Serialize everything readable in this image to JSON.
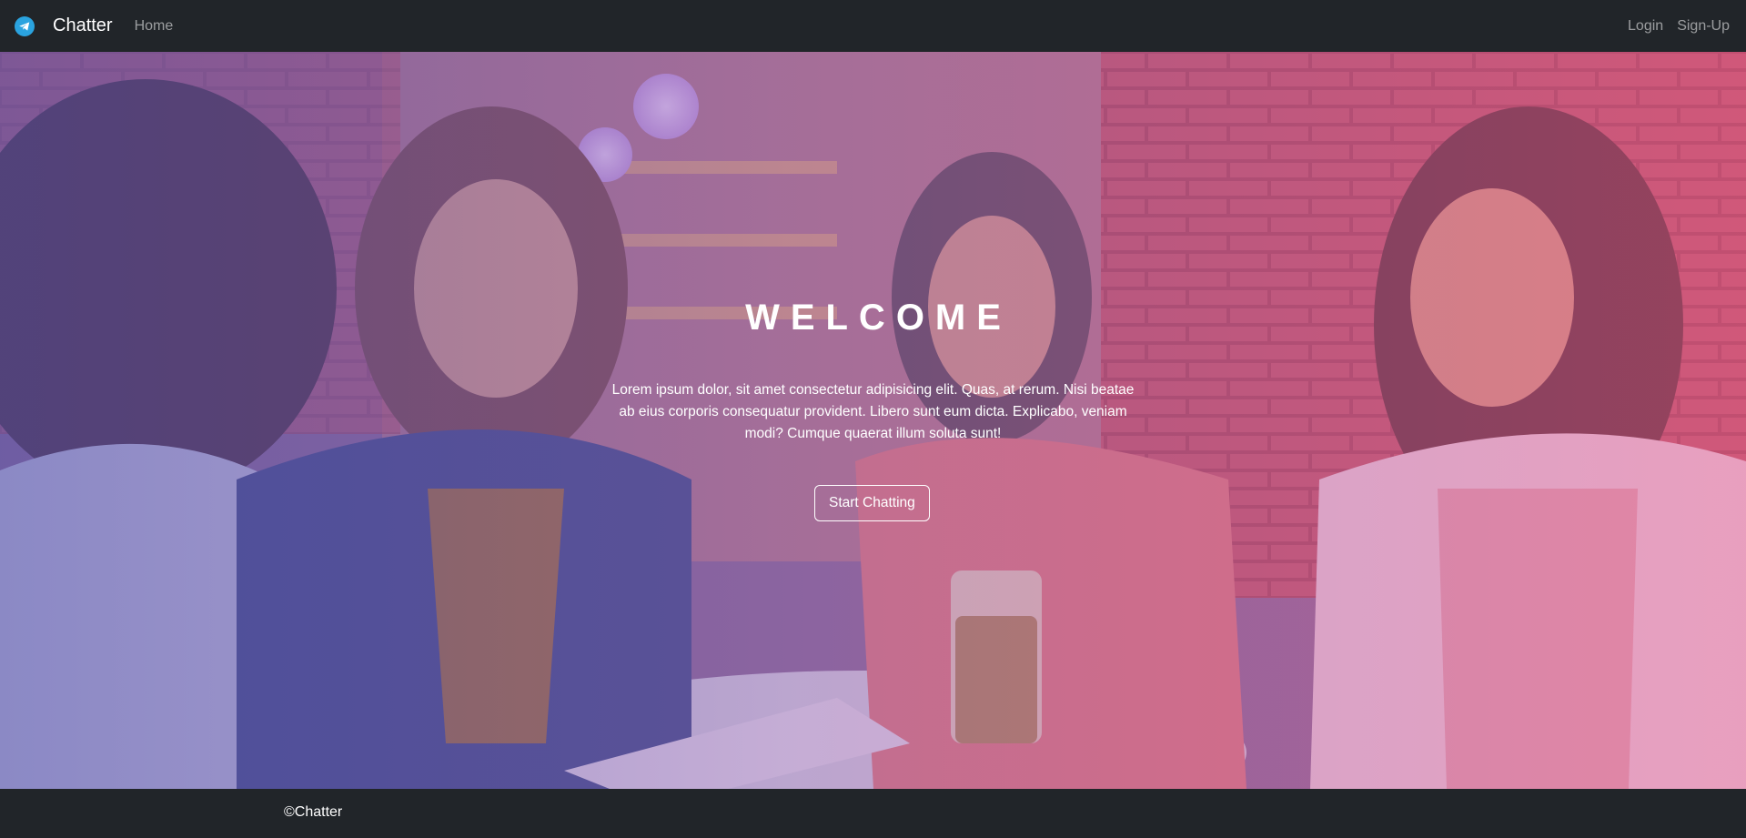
{
  "nav": {
    "brand": "Chatter",
    "brand_icon": "telegram-icon",
    "home": "Home",
    "login": "Login",
    "signup": "Sign-Up"
  },
  "hero": {
    "title": "WELCOME",
    "text": "Lorem ipsum dolor, sit amet consectetur adipisicing elit. Quas, at rerum. Nisi beatae ab eius corporis consequatur provident. Libero sunt eum dicta. Explicabo, veniam modi? Cumque quaerat illum soluta sunt!",
    "button": "Start Chatting"
  },
  "footer": {
    "text": "©Chatter"
  },
  "colors": {
    "navbar": "#212529",
    "footer": "#212529",
    "brand_icon": "#2aa3df",
    "overlay_left": "#5852aa",
    "overlay_right": "#e15a8c"
  }
}
